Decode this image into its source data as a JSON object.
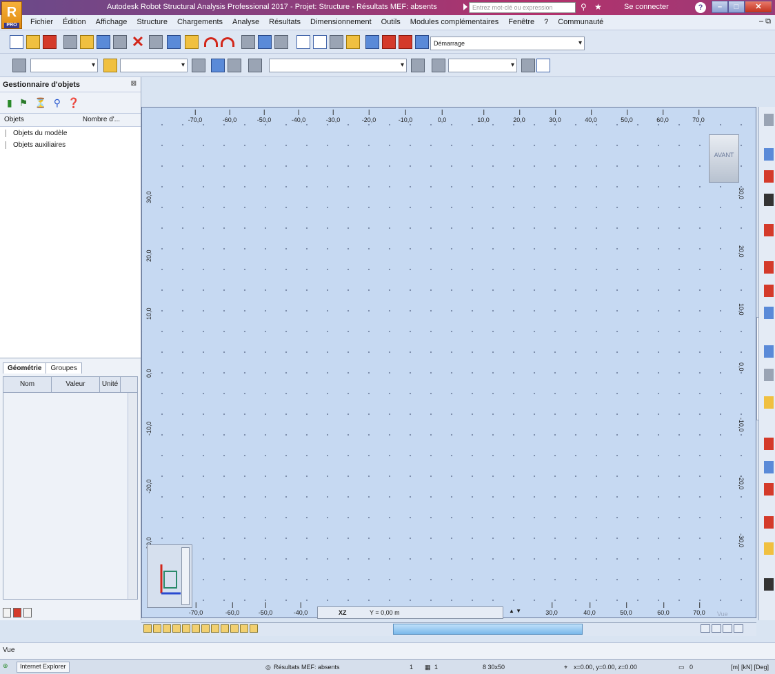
{
  "titlebar": {
    "title": "Autodesk Robot Structural Analysis Professional 2017 - Projet: Structure - Résultats MEF: absents",
    "search_placeholder": "Entrez mot-clé ou expression",
    "signin": "Se connecter",
    "help": "?",
    "logo_letter": "R",
    "logo_sub": "PRO"
  },
  "menu": [
    "Fichier",
    "Édition",
    "Affichage",
    "Structure",
    "Chargements",
    "Analyse",
    "Résultats",
    "Dimensionnement",
    "Outils",
    "Modules complémentaires",
    "Fenêtre",
    "?",
    "Communauté"
  ],
  "toolbar": {
    "layout_select": "Démarrage"
  },
  "left_panel": {
    "title": "Gestionnaire d'objets",
    "col_objects": "Objets",
    "col_count": "Nombre d'...",
    "tree": [
      "Objets du modèle",
      "Objets auxiliaires"
    ],
    "tabs": [
      "Géométrie",
      "Groupes"
    ],
    "props_cols": [
      "Nom",
      "Valeur",
      "Unité"
    ]
  },
  "view": {
    "top_ticks": [
      "-70,0",
      "-60,0",
      "-50,0",
      "-40,0",
      "-30,0",
      "-20,0",
      "-10,0",
      "0,0",
      "10,0",
      "20,0",
      "30,0",
      "40,0",
      "50,0",
      "60,0",
      "70,0"
    ],
    "left_ticks": [
      "30,0",
      "20,0",
      "10,0",
      "0,0",
      "-10,0",
      "-20,0",
      "-30,0"
    ],
    "bottom_ticks": [
      "-70,0",
      "-60,0",
      "-50,0",
      "-40,0",
      "30,0",
      "40,0",
      "50,0",
      "60,0",
      "70,0"
    ],
    "view_cube": "AVANT",
    "plane": "XZ",
    "y_position": "Y = 0,00 m",
    "right_label": "Vue"
  },
  "status": {
    "view_label": "Vue",
    "ie_label": "Internet Explorer",
    "results": "Résultats MEF: absents",
    "num1": "1",
    "num2": "1",
    "nodes": "8 30x50",
    "coords": "x=0.00, y=0.00, z=0.00",
    "zero": "0",
    "units": "[m] [kN] [Deg]"
  }
}
